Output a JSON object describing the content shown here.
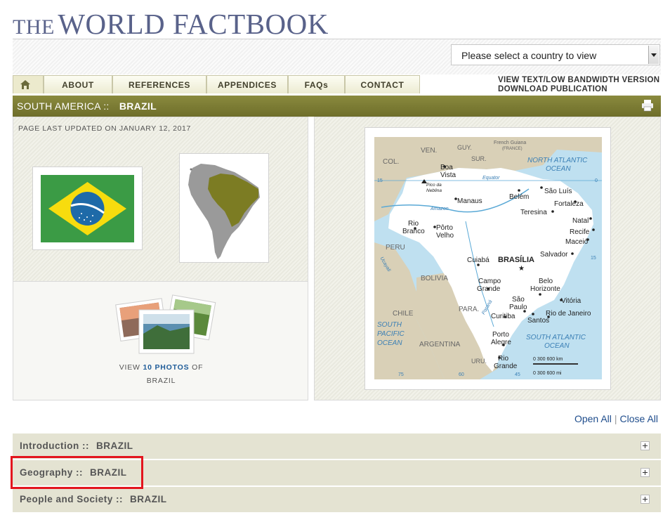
{
  "logo": {
    "the": "THE",
    "main": "WORLD FACTBOOK"
  },
  "country_select": {
    "value": "Please select a country to view"
  },
  "nav": {
    "tabs": [
      {
        "label": "ABOUT"
      },
      {
        "label": "REFERENCES"
      },
      {
        "label": "APPENDICES"
      },
      {
        "label": "FAQs"
      },
      {
        "label": "CONTACT"
      }
    ],
    "text_version": "VIEW TEXT/LOW BANDWIDTH VERSION",
    "download": "DOWNLOAD PUBLICATION"
  },
  "breadcrumb": {
    "region": "SOUTH AMERICA ::",
    "country": "BRAZIL"
  },
  "updated": "PAGE LAST UPDATED ON JANUARY 12, 2017",
  "photos": {
    "view": "VIEW",
    "count": "10 PHOTOS",
    "of": "OF",
    "country": "BRAZIL"
  },
  "map_labels": {
    "ven": "VEN.",
    "guy": "GUY.",
    "sur": "SUR.",
    "fg1": "French Guiana",
    "fg2": "(FRANCE)",
    "col": "COL.",
    "boa1": "Boa",
    "boa2": "Vista",
    "pico1": "Pico da",
    "pico2": "Neblina",
    "equator": "Equator",
    "nao1": "NORTH ATLANTIC",
    "nao2": "OCEAN",
    "belem": "Belém",
    "saoluis": "São Luís",
    "fortaleza": "Fortaleza",
    "manaus": "Manaus",
    "teresina": "Teresina",
    "amazon": "Amazon",
    "natal": "Natal",
    "recife": "Recife",
    "maceio": "Maceió",
    "rio1": "Rio",
    "rio2": "Branco",
    "porto1": "Pôrto",
    "porto2": "Velho",
    "peru": "PERU",
    "salvador": "Salvador",
    "cuiaba": "Cuiabá",
    "brasilia": "BRASÍLIA",
    "bolivia": "BOLIVIA",
    "campo1": "Campo",
    "campo2": "Grande",
    "belo1": "Belo",
    "belo2": "Horizonte",
    "chile": "CHILE",
    "para": "PARA.",
    "saopaulo1": "São",
    "saopaulo2": "Paulo",
    "vitoria": "Vitória",
    "curitiba": "Curitiba",
    "santos": "Santos",
    "riojan": "Rio de Janeiro",
    "spo1": "SOUTH",
    "spo2": "PACIFIC",
    "spo3": "OCEAN",
    "sao1": "SOUTH ATLANTIC",
    "sao2": "OCEAN",
    "argentina": "ARGENTINA",
    "pa1": "Porto",
    "pa2": "Alegre",
    "uru": "URU.",
    "rg1": "Rio",
    "rg2": "Grande",
    "scale_km": "0    300  600 km",
    "scale_mi": "0      300     600 mi",
    "ucayali": "Ucayali",
    "parana": "Paraná",
    "n75": "75",
    "n60": "60",
    "n45": "45",
    "n15": "15",
    "n0": "0",
    "n15b": "15"
  },
  "open_all": "Open All",
  "close_all": "Close All",
  "sections": [
    {
      "title": "Introduction ::",
      "country": "BRAZIL"
    },
    {
      "title": "Geography ::",
      "country": "BRAZIL"
    },
    {
      "title": "People and Society ::",
      "country": "BRAZIL"
    }
  ],
  "colors": {
    "olive": "#7d7d34",
    "section_bg": "#e4e3d2",
    "highlight": "#e3151e",
    "link": "#1f4d8c",
    "ocean": "#bfe0f0"
  }
}
